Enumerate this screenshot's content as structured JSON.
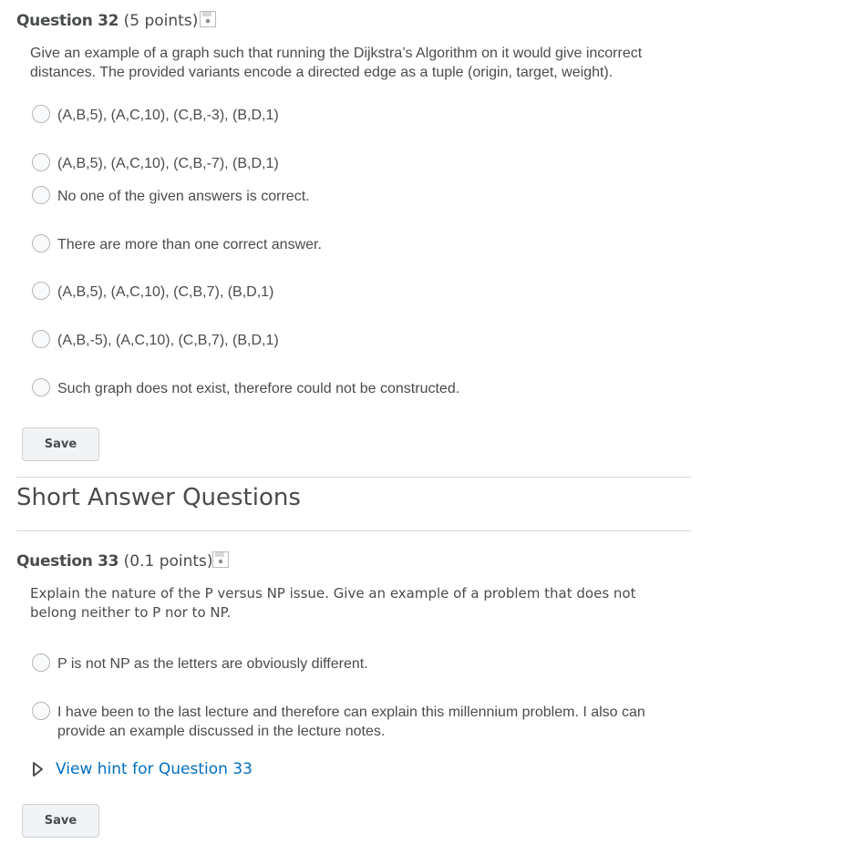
{
  "question32": {
    "name": "Question 32",
    "points": "(5 points)",
    "prompt": "Give an example of a graph such that running the Dijkstra’s Algorithm on it would give incorrect distances. The provided variants encode a directed edge as a tuple (origin, target, weight).",
    "options": [
      "(A,B,5), (A,C,10), (C,B,-3), (B,D,1)",
      "(A,B,5), (A,C,10), (C,B,-7), (B,D,1)",
      "No one of the given answers is correct.",
      "There are more than one correct answer.",
      "(A,B,5), (A,C,10), (C,B,7), (B,D,1)",
      "(A,B,-5), (A,C,10), (C,B,7), (B,D,1)",
      "Such graph does not exist, therefore could not be constructed."
    ],
    "save_label": "Save"
  },
  "section": {
    "title": "Short Answer Questions"
  },
  "question33": {
    "name": "Question 33",
    "points": "(0.1 points)",
    "prompt": "Explain the nature of the P versus NP issue. Give an example of a problem that does not belong neither to P nor to NP.",
    "options": [
      "P is not NP as the letters are obviously different.",
      "I have been to the last lecture and therefore can explain this millennium problem. I also can provide an example discussed in the lecture notes."
    ],
    "hint_label": "View hint for Question 33",
    "save_label": "Save"
  },
  "icons": {
    "save_status": "floppy-disk-icon",
    "hint_toggle": "triangle-right-outline-icon"
  },
  "colors": {
    "text": "#494c4e",
    "link": "#006fbf",
    "divider": "#d3d9e3",
    "button_bg": "#f1f3f5"
  }
}
